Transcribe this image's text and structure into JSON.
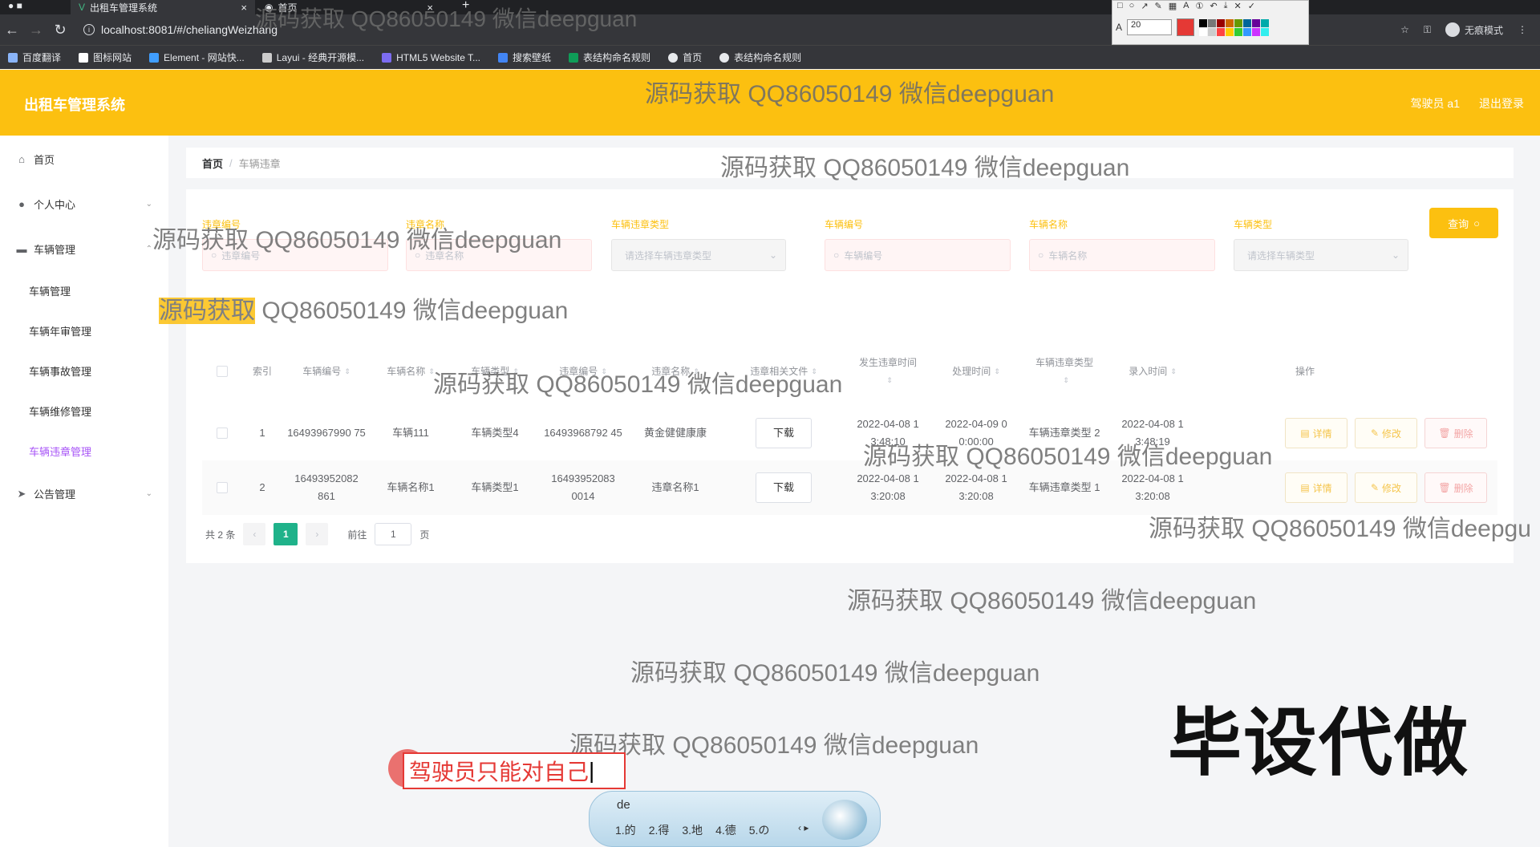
{
  "browser": {
    "tabs": [
      {
        "label": "出租车管理系统"
      },
      {
        "label": "首页"
      }
    ],
    "url": "localhost:8081/#/cheliangWeizhang",
    "incognito_label": "无痕模式",
    "bookmarks": [
      "百度翻译",
      "图标网站",
      "Element - 网站快...",
      "Layui - 经典开源模...",
      "HTML5 Website T...",
      "搜索壁纸",
      "表结构命名规则",
      "首页",
      "表结构命名规则"
    ],
    "annotation_toolbar": {
      "font_size": "20",
      "color": "#e53935"
    }
  },
  "header": {
    "title": "出租车管理系统",
    "user_label": "驾驶员 a1",
    "logout_label": "退出登录",
    "brand_color": "#fcc010"
  },
  "sidebar": {
    "items": [
      {
        "label": "首页",
        "icon": "home-icon"
      },
      {
        "label": "个人中心",
        "icon": "user-icon"
      },
      {
        "label": "车辆管理",
        "icon": "briefcase-icon"
      },
      {
        "label": "公告管理",
        "icon": "send-icon"
      }
    ],
    "sub_items": [
      "车辆管理",
      "车辆年审管理",
      "车辆事故管理",
      "车辆维修管理",
      "车辆违章管理"
    ],
    "active_sub": "车辆违章管理"
  },
  "breadcrumb": {
    "home": "首页",
    "separator": "/",
    "current": "车辆违章"
  },
  "filters": {
    "labels": [
      "违章编号",
      "违章名称",
      "车辆违章类型",
      "车辆编号",
      "车辆名称",
      "车辆类型"
    ],
    "placeholders": [
      "违章编号",
      "违章名称",
      "请选择车辆违章类型",
      "车辆编号",
      "车辆名称",
      "请选择车辆类型"
    ],
    "search_label": "查询"
  },
  "table": {
    "columns": [
      "索引",
      "车辆编号",
      "车辆名称",
      "车辆类型",
      "违章编号",
      "违章名称",
      "违章相关文件",
      "发生违章时间",
      "处理时间",
      "车辆违章类型",
      "录入时间",
      "操作"
    ],
    "rows": [
      {
        "index": "1",
        "car_no": "16493967990 75",
        "car_name": "车辆111",
        "car_type": "车辆类型4",
        "vio_no": "16493968792 45",
        "vio_name": "黄金健健康康",
        "file_btn": "下载",
        "occur_time": "2022-04-08 1 3:48:10",
        "handle_time": "2022-04-09 0 0:00:00",
        "vio_type": "车辆违章类型 2",
        "entry_time": "2022-04-08 1 3:48:19"
      },
      {
        "index": "2",
        "car_no": "16493952082 861",
        "car_name": "车辆名称1",
        "car_type": "车辆类型1",
        "vio_no": "16493952083 0014",
        "vio_name": "违章名称1",
        "file_btn": "下载",
        "occur_time": "2022-04-08 1 3:20:08",
        "handle_time": "2022-04-08 1 3:20:08",
        "vio_type": "车辆违章类型 1",
        "entry_time": "2022-04-08 1 3:20:08"
      }
    ],
    "actions": {
      "detail": "详情",
      "edit": "修改",
      "delete": "删除"
    }
  },
  "pagination": {
    "total": "共 2 条",
    "current_page": "1",
    "goto_label": "前往",
    "goto_value": "1",
    "page_suffix": "页"
  },
  "watermarks": {
    "text": "源码获取 QQ86050149 微信deepguan",
    "text_cut": "源码获取 QQ86050149 微信deepgu",
    "hl_a": "源码获取",
    "hl_b": "QQ86050149 微信deepguan",
    "stamp": "毕设代做"
  },
  "annotation_text": "驾驶员只能对自己",
  "ime": {
    "typed": "de",
    "candidates": [
      "1.的",
      "2.得",
      "3.地",
      "4.德",
      "5.の"
    ]
  }
}
